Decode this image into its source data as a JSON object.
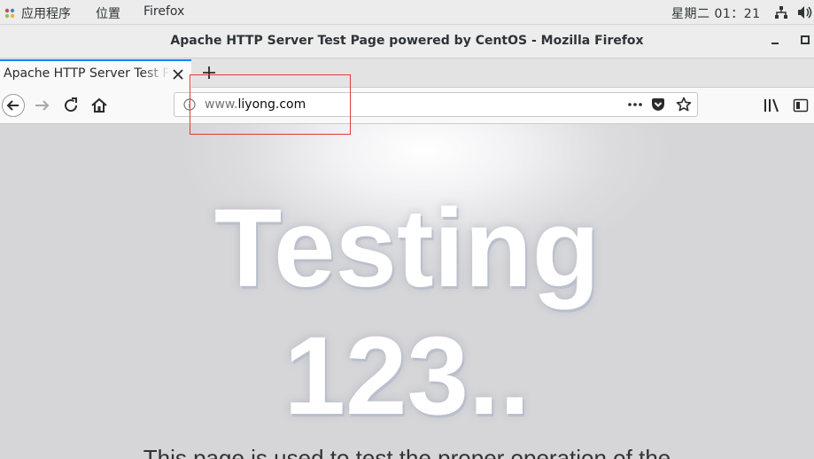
{
  "topbar": {
    "applications": "应用程序",
    "places": "位置",
    "app_name": "Firefox",
    "clock": "星期二 01：21"
  },
  "window": {
    "title": "Apache HTTP Server Test Page powered by CentOS - Mozilla Firefox"
  },
  "tab": {
    "label": "Apache HTTP Server Test Page powered by CentOS"
  },
  "urlbar": {
    "prefix": "www.",
    "host": "liyong.com"
  },
  "page": {
    "headline_line1": "Testing",
    "headline_line2": "123..",
    "lead": "This page is used to test the proper operation of the"
  },
  "colors": {
    "tab_accent": "#0a84ff",
    "annotation": "#e03a3a"
  }
}
